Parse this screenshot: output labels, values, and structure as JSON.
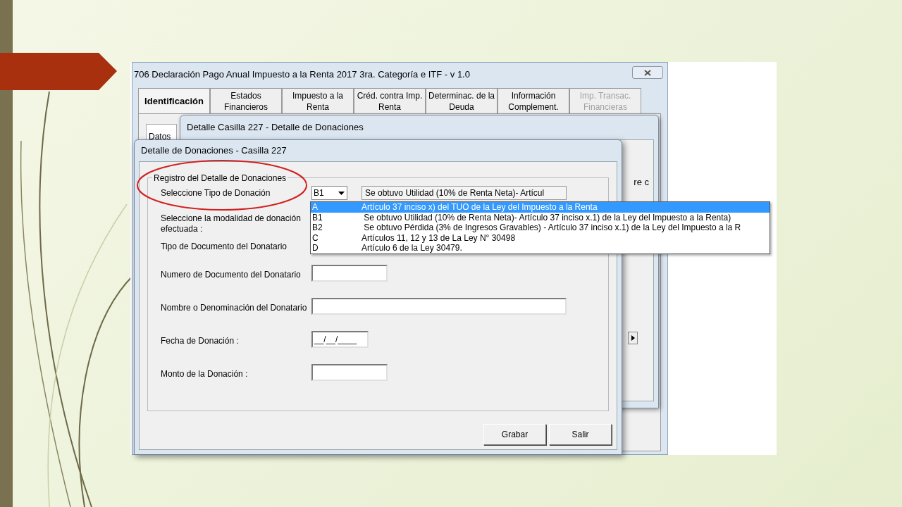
{
  "main_window": {
    "title": "706 Declaración Pago Anual Impuesto a la Renta 2017 3ra. Categoría e ITF - v 1.0",
    "tabs": [
      {
        "label": "Identificación",
        "selected": true,
        "disabled": false
      },
      {
        "label": "Estados\nFinancieros",
        "selected": false,
        "disabled": false
      },
      {
        "label": "Impuesto a  la\nRenta",
        "selected": false,
        "disabled": false
      },
      {
        "label": "Créd. contra Imp.\nRenta",
        "selected": false,
        "disabled": false
      },
      {
        "label": "Determinac. de la\nDeuda",
        "selected": false,
        "disabled": false
      },
      {
        "label": "Información\nComplement.",
        "selected": false,
        "disabled": false
      },
      {
        "label": "Imp. Transac.\nFinancieras",
        "selected": false,
        "disabled": true
      }
    ],
    "subtab": "Datos"
  },
  "detail_window": {
    "title": "Detalle Casilla 227 - Detalle de Donaciones",
    "partial_text": "re c"
  },
  "dialog": {
    "title": "Detalle de Donaciones -  Casilla 227",
    "group": "Registro del Detalle de Donaciones",
    "fields": [
      {
        "kind": "combo",
        "label": "Seleccione Tipo de Donación",
        "value": "B1",
        "description": "Se obtuvo Utilidad (10% de Renta Neta)- Artícul"
      },
      {
        "kind": "none",
        "label": "Seleccione la modalidad de donación efectuada :"
      },
      {
        "kind": "none",
        "label": "Tipo de Documento del Donatario"
      },
      {
        "kind": "short",
        "label": "Numero de Documento del Donatario"
      },
      {
        "kind": "long",
        "label": "Nombre o Denominación del Donatario"
      },
      {
        "kind": "date",
        "label": "Fecha de Donación :",
        "value": "__/__/____"
      },
      {
        "kind": "short",
        "label": "Monto de la Donación :"
      }
    ],
    "buttons": [
      "Grabar",
      "Salir"
    ]
  },
  "dropdown": {
    "options": [
      {
        "code": "A",
        "text": "Artículo 37 inciso x) del TUO de la Ley del Impuesto a la Renta",
        "selected": true
      },
      {
        "code": "B1",
        "text": " Se obtuvo Utilidad (10% de Renta Neta)- Artículo 37 inciso x.1) de la Ley del Impuesto a la Renta)",
        "selected": false
      },
      {
        "code": "B2",
        "text": " Se obtuvo Pérdida (3% de Ingresos Gravables) - Artículo 37 inciso x.1) de la Ley del Impuesto a la R",
        "selected": false
      },
      {
        "code": "C",
        "text": "Artículos 11, 12 y 13 de La Ley N° 30498",
        "selected": false
      },
      {
        "code": "D",
        "text": "Artículo 6 de la Ley 30479.",
        "selected": false
      }
    ]
  }
}
